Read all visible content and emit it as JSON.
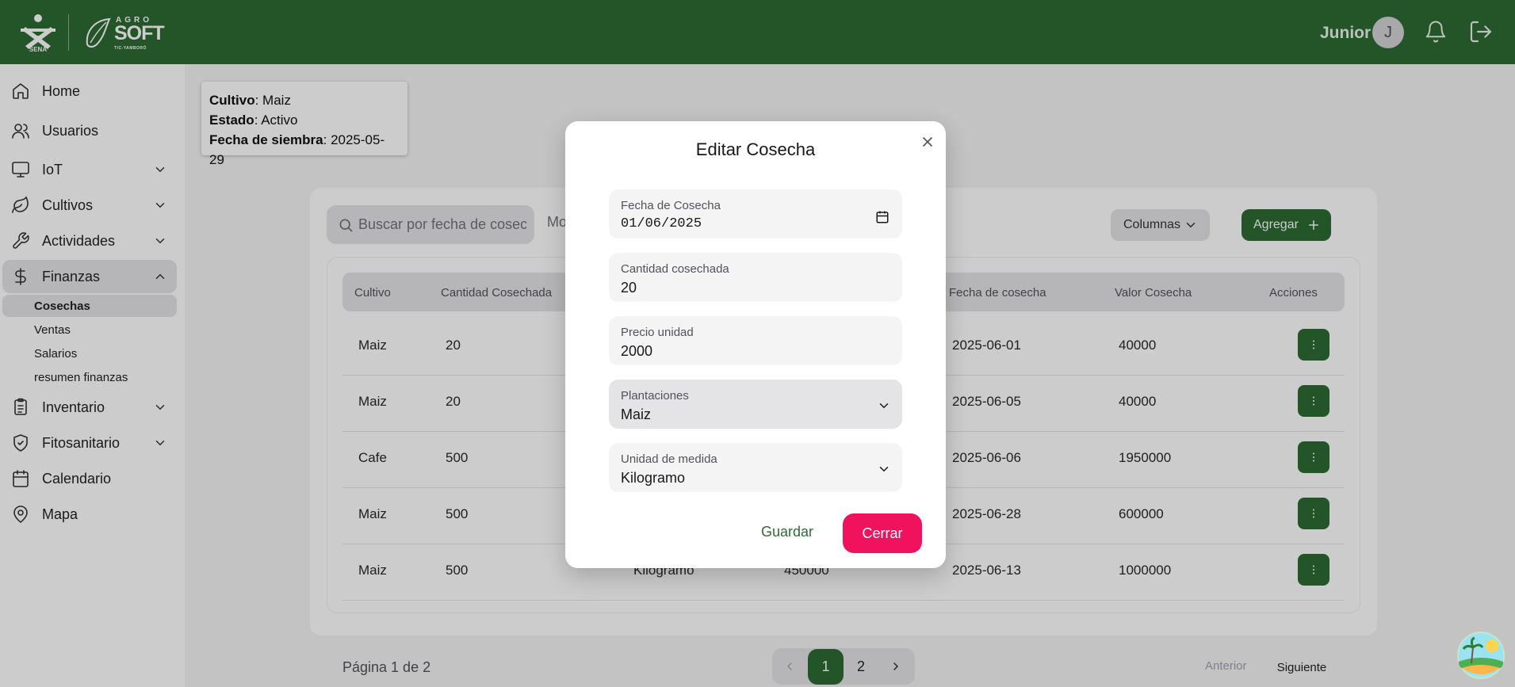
{
  "header": {
    "logo_sena": "SENA",
    "logo_agro": "AGRO",
    "logo_soft": "SOFT",
    "logo_tagline": "TIC-YAMBORÓ",
    "user_name": "Junior",
    "avatar_initial": "J",
    "icons": [
      "bell-icon",
      "logout-icon"
    ],
    "color": "#2e6b34"
  },
  "sidebar": {
    "items": [
      {
        "label": "Home",
        "icon": "home-icon"
      },
      {
        "label": "Usuarios",
        "icon": "users-icon"
      },
      {
        "label": "IoT",
        "icon": "monitor-icon"
      },
      {
        "label": "Cultivos",
        "icon": "leaf-icon"
      },
      {
        "label": "Actividades",
        "icon": "wrench-icon"
      },
      {
        "label": "Finanzas",
        "icon": "dollar-icon"
      },
      {
        "label": "Inventario",
        "icon": "clipboard-icon"
      },
      {
        "label": "Fitosanitario",
        "icon": "shield-icon"
      },
      {
        "label": "Calendario",
        "icon": "calendar-icon"
      },
      {
        "label": "Mapa",
        "icon": "map-pin-icon"
      }
    ],
    "finanzas_sub": [
      "Cosechas",
      "Ventas",
      "Salarios",
      "resumen finanzas"
    ]
  },
  "info": {
    "cultivo_label": "Cultivo",
    "cultivo_value": ": Maiz",
    "estado_label": "Estado",
    "estado_value": ": Activo",
    "fecha_label": "Fecha de siembra",
    "fecha_value": ": 2025-05-29"
  },
  "toolbar": {
    "search_placeholder": "Buscar por fecha de cosecha",
    "partial_text": "Mo",
    "columns_label": "Columnas",
    "add_label": "Agregar"
  },
  "table": {
    "headers": [
      "Cultivo",
      "Cantidad Cosechada",
      "Fecha de cosecha",
      "Valor Cosecha",
      "Acciones"
    ],
    "rows": [
      {
        "cultivo": "Maiz",
        "cantidad": "20",
        "unidad": "",
        "precio": "",
        "fecha": "2025-06-01",
        "valor": "40000"
      },
      {
        "cultivo": "Maiz",
        "cantidad": "20",
        "unidad": "",
        "precio": "",
        "fecha": "2025-06-05",
        "valor": "40000"
      },
      {
        "cultivo": "Cafe",
        "cantidad": "500",
        "unidad": "",
        "precio": "",
        "fecha": "2025-06-06",
        "valor": "1950000"
      },
      {
        "cultivo": "Maiz",
        "cantidad": "500",
        "unidad": "",
        "precio": "",
        "fecha": "2025-06-28",
        "valor": "600000"
      },
      {
        "cultivo": "Maiz",
        "cantidad": "500",
        "unidad": "Kilogramo",
        "precio": "450000",
        "fecha": "2025-06-13",
        "valor": "1000000"
      }
    ]
  },
  "pagination": {
    "status": "Página 1 de 2",
    "page1": "1",
    "page2": "2",
    "prev_label": "Anterior",
    "next_label": "Siguiente"
  },
  "modal": {
    "title": "Editar Cosecha",
    "fields": [
      {
        "label": "Fecha de Cosecha",
        "value": "01/06/2025"
      },
      {
        "label": "Cantidad cosechada",
        "value": "20"
      },
      {
        "label": "Precio unidad",
        "value": "2000"
      },
      {
        "label": "Plantaciones",
        "value": "Maiz"
      },
      {
        "label": "Unidad de medida",
        "value": "Kilogramo"
      }
    ],
    "save_label": "Guardar",
    "close_label": "Cerrar",
    "accent": "#f0125d"
  }
}
